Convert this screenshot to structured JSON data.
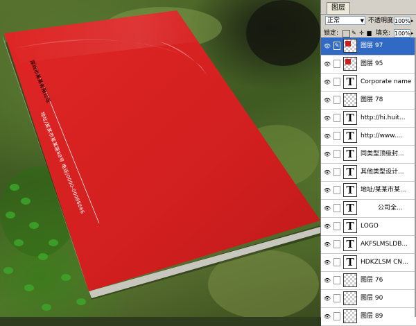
{
  "cover": {
    "cover_color": "#d62020",
    "vertical_lines": [
      "深圳市某某有限公司",
      "地址/某某市某某路88号  电话/0000-00088666"
    ]
  },
  "panel": {
    "tab_label": "图层",
    "blend_mode": "正常",
    "opacity_label": "不透明度:",
    "opacity_value": "100%",
    "lock_label": "锁定:",
    "fill_label": "填充:",
    "fill_value": "100%",
    "layers": [
      {
        "name": "图层 97",
        "type": "image",
        "selected": true,
        "red": true
      },
      {
        "name": "图层 95",
        "type": "image",
        "selected": false,
        "red": true
      },
      {
        "name": "Corporate name",
        "type": "text",
        "selected": false
      },
      {
        "name": "图层 78",
        "type": "image",
        "selected": false
      },
      {
        "name": "http://hi.huit...",
        "type": "text",
        "selected": false
      },
      {
        "name": "http://www....",
        "type": "text",
        "selected": false
      },
      {
        "name": "同类型顶级封...",
        "type": "text",
        "selected": false
      },
      {
        "name": "其他类型设计...",
        "type": "text",
        "selected": false
      },
      {
        "name": "地址/某某市某...",
        "type": "text",
        "selected": false
      },
      {
        "name": "公司全...",
        "type": "text",
        "selected": false,
        "indent": true
      },
      {
        "name": "LOGO",
        "type": "text",
        "selected": false
      },
      {
        "name": "AKFSLMSLDB...",
        "type": "text",
        "selected": false
      },
      {
        "name": "HDKZLSM CN...",
        "type": "text",
        "selected": false
      },
      {
        "name": "图层 76",
        "type": "image",
        "selected": false
      },
      {
        "name": "图层 90",
        "type": "image",
        "selected": false
      },
      {
        "name": "图层 89",
        "type": "image",
        "selected": false
      }
    ]
  }
}
